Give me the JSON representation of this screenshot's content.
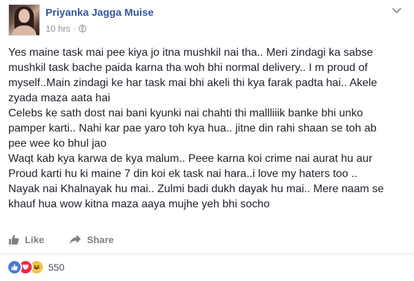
{
  "post": {
    "author": "Priyanka Jagga Muise",
    "time": "10 hrs",
    "separator": "·",
    "privacy_icon": "globe-icon",
    "menu_icon": "chevron-down-icon",
    "body_lines": [
      "Yes maine task mai pee kiya jo itna mushkil nai tha.. Meri zindagi ka sabse",
      "mushkil task bache paida karna tha woh bhi normal delivery.. I m proud of",
      "myself..Main zindagi ke har task mai bhi akeli thi kya farak padta hai.. Akele",
      "zyada maza aata hai",
      "Celebs ke sath dost nai bani kyunki nai chahti thi mallliiik banke bhi unko",
      "pamper karti.. Nahi kar pae yaro toh kya hua.. jitne din rahi shaan se toh ab",
      "pee wee ko bhul jao",
      "Waqt kab kya karwa de kya malum.. Peee karna koi crime nai aurat hu aur",
      "Proud karti hu ki maine 7 din koi ek task nai hara..i love my haters too ..",
      "Nayak nai Khalnayak hu mai.. Zulmi badi dukh dayak hu mai.. Mere naam se",
      "khauf hua wow kitna maza aaya mujhe yeh bhi socho"
    ]
  },
  "actions": {
    "like_label": "Like",
    "share_label": "Share"
  },
  "reactions": {
    "icons": [
      "like-reaction-icon",
      "love-reaction-icon",
      "haha-reaction-icon"
    ],
    "count": "550"
  },
  "colors": {
    "author_link": "#365899",
    "meta_text": "#90949c",
    "action_text": "#7f7f7f"
  }
}
